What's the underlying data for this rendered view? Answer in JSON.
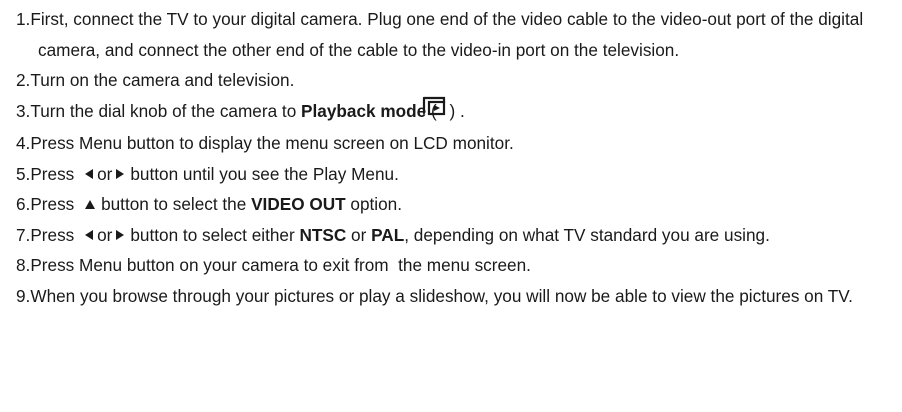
{
  "steps": [
    {
      "num": "1.",
      "text": "First, connect the TV to your digital camera. Plug one end of the video cable to the video-out port of the digital camera, and connect the other end of the cable to the video-in port on the television."
    },
    {
      "num": "2.",
      "text": "Turn on the camera and television."
    },
    {
      "num": "3.",
      "pre": "Turn the dial knob of the camera to ",
      "bold": "Playback mode",
      "open": " ( ",
      "close": ") .",
      "icon": "playback-mode-icon"
    },
    {
      "num": "4.",
      "text": "Press Menu button to display the menu screen on LCD monitor."
    },
    {
      "num": "5.",
      "pre": "Press ",
      "or": "or",
      "post": "button until you see the Play Menu.",
      "icons": [
        "left-arrow-icon",
        "right-arrow-icon"
      ]
    },
    {
      "num": "6.",
      "pre": "Press ",
      "mid": "button to select the ",
      "bold": "VIDEO OUT",
      "post": " option.",
      "icon": "up-arrow-icon"
    },
    {
      "num": "7.",
      "pre": "Press ",
      "or": "or",
      "mid": "button to select either ",
      "bold1": "NTSC",
      "or2": " or ",
      "bold2": "PAL",
      "post": ", depending on what TV standard you are using.",
      "icons": [
        "left-arrow-icon",
        "right-arrow-icon"
      ]
    },
    {
      "num": "8.",
      "text": "Press Menu button on your camera to exit from  the menu screen."
    },
    {
      "num": "9.",
      "text": "When you browse through your pictures or play a slideshow, you will now be able to view the pictures on TV."
    }
  ]
}
